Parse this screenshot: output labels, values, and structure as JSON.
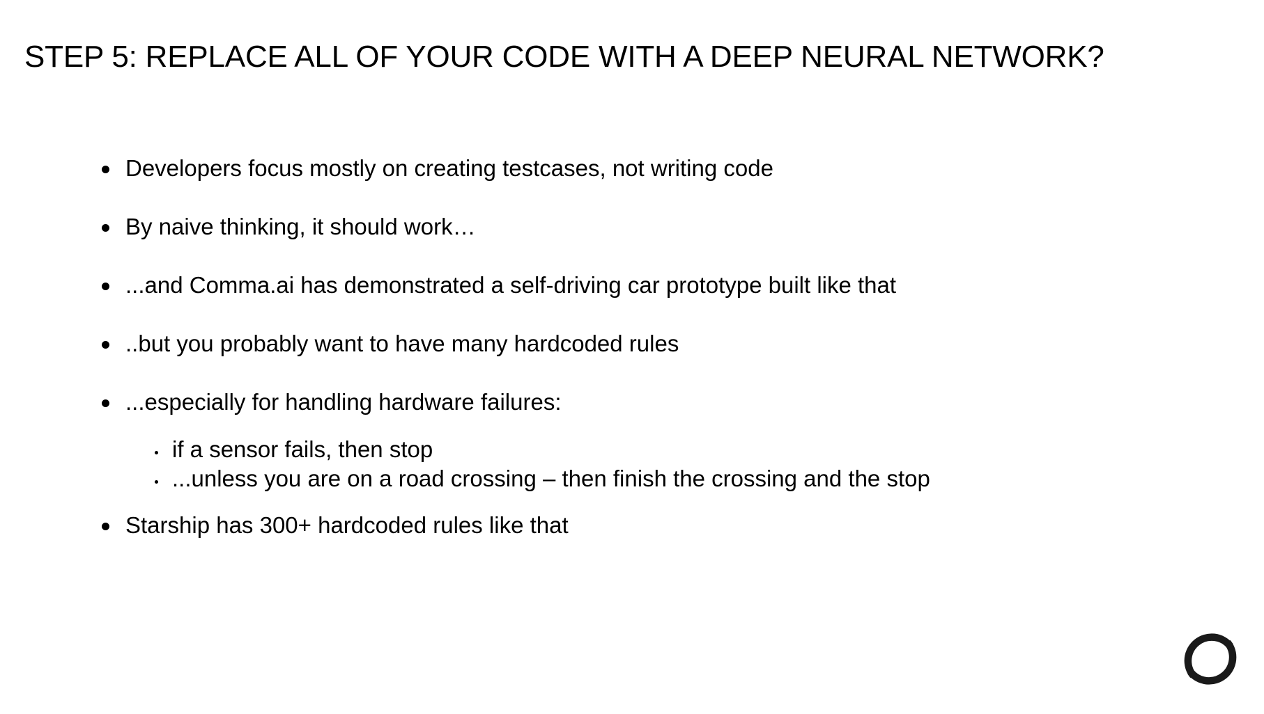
{
  "slide": {
    "title": "STEP 5: REPLACE ALL OF YOUR CODE WITH A DEEP NEURAL NETWORK?",
    "bullets": [
      "Developers focus mostly on creating testcases, not writing code",
      "By naive thinking, it should work…",
      "...and Comma.ai has demonstrated a self-driving car prototype built like that",
      "..but you probably want to have many hardcoded rules",
      "...especially for handling hardware failures:",
      "Starship has 300+ hardcoded rules like that"
    ],
    "sub_bullets": [
      "if a sensor fails, then stop",
      "...unless you are on a road crossing – then finish the crossing and the stop"
    ]
  },
  "logo": {
    "icon": "brand-logo-icon",
    "color": "#1a1a1a"
  }
}
